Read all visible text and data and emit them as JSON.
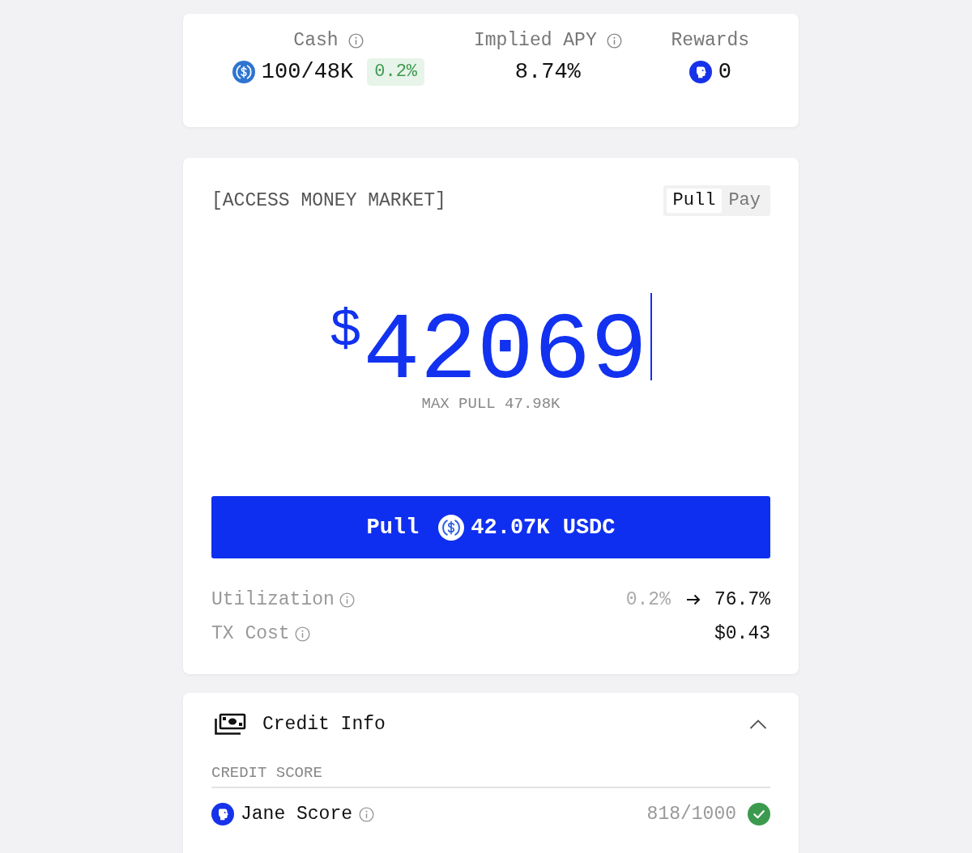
{
  "stats": [
    {
      "kind": "cash",
      "label": "Cash",
      "info": true,
      "value": "100/48K",
      "badge": "0.2%"
    },
    {
      "kind": "rate",
      "label": "Implied APY",
      "info": true,
      "value": "8.74%"
    },
    {
      "kind": "reward",
      "label": "Rewards",
      "info": false,
      "value": "0"
    }
  ],
  "market": {
    "title": "[ACCESS MONEY MARKET]",
    "modes": [
      {
        "label": "Pull",
        "selected": true
      },
      {
        "label": "Pay",
        "selected": false
      }
    ],
    "amount": {
      "currency": "$",
      "value": "42069"
    },
    "max_note": "MAX PULL 47.98K",
    "action": {
      "label": "Pull",
      "amount": "42.07K USDC"
    },
    "details": [
      {
        "label": "Utilization",
        "info": true,
        "from": "0.2%",
        "to": "76.7%"
      },
      {
        "label": "TX Cost",
        "info": true,
        "to": "$0.43"
      }
    ]
  },
  "credit_info": {
    "title": "Credit Info",
    "expanded": true,
    "section": "CREDIT SCORE",
    "rows": [
      {
        "label": "Jane Score",
        "info": true,
        "value": "818/1000",
        "verified": true
      }
    ]
  }
}
